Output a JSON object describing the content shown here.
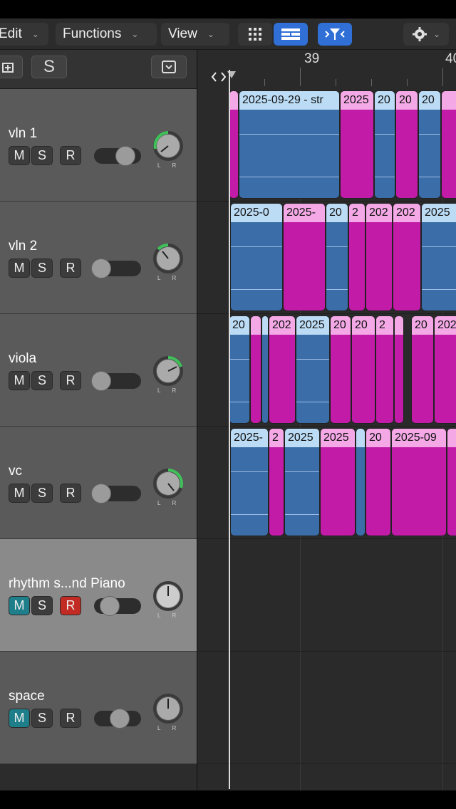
{
  "menus": {
    "edit": "Edit",
    "functions": "Functions",
    "view": "View"
  },
  "header": {
    "solo_label": "S"
  },
  "ruler": {
    "bars": [
      "39",
      "40"
    ]
  },
  "tracks": [
    {
      "name": "vln 1",
      "m": "M",
      "s": "S",
      "r": "R"
    },
    {
      "name": "vln 2",
      "m": "M",
      "s": "S",
      "r": "R"
    },
    {
      "name": "viola",
      "m": "M",
      "s": "S",
      "r": "R"
    },
    {
      "name": "vc",
      "m": "M",
      "s": "S",
      "r": "R"
    },
    {
      "name": "rhythm s...nd Piano",
      "m": "M",
      "s": "S",
      "r": "R"
    },
    {
      "name": "space",
      "m": "M",
      "s": "S",
      "r": "R"
    }
  ],
  "regions": {
    "lane0": [
      "2025-09-29 - str",
      "2025",
      "20",
      "20",
      "20",
      ""
    ],
    "lane1": [
      "2025-0",
      "2025-",
      "20",
      "2",
      "202",
      "202",
      "2025"
    ],
    "lane2": [
      "20",
      "",
      "",
      "202",
      "2025",
      "20",
      "20",
      "2",
      "",
      "20",
      "202"
    ],
    "lane3": [
      "2025-",
      "2",
      "2025",
      "2025",
      "",
      "20",
      "2025-09",
      ""
    ]
  },
  "colors": {
    "mute_on": "#1e7f8a",
    "record_on": "#c22b23",
    "region_blue": "#3b6ea8",
    "region_pink": "#c21ba7",
    "accent": "#2f6fd6"
  },
  "icons": [
    "chevron-down-icon",
    "grid-icon",
    "list-icon",
    "catch-icon",
    "gear-icon",
    "add-track-icon",
    "dropdown-icon",
    "pan-knob-icon"
  ]
}
